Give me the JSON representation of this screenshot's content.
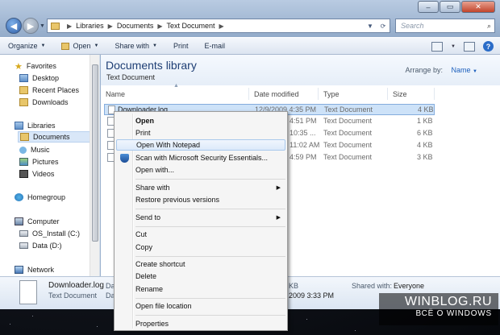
{
  "window": {
    "controls": [
      "–",
      "▭",
      "✕"
    ],
    "breadcrumbs": [
      "Libraries",
      "Documents",
      "Text Document"
    ],
    "search_placeholder": "Search"
  },
  "toolbar": {
    "organize": "Organize",
    "open": "Open",
    "share_with": "Share with",
    "print": "Print",
    "email": "E-mail"
  },
  "nav": {
    "favorites": "Favorites",
    "desktop": "Desktop",
    "recent_places": "Recent Places",
    "downloads": "Downloads",
    "libraries": "Libraries",
    "documents": "Documents",
    "music": "Music",
    "pictures": "Pictures",
    "videos": "Videos",
    "homegroup": "Homegroup",
    "computer": "Computer",
    "os_install": "OS_Install (C:)",
    "data_drive": "Data (D:)",
    "network": "Network"
  },
  "library": {
    "title": "Documents library",
    "subtitle": "Text Document",
    "arrange_label": "Arrange by:",
    "arrange_value": "Name"
  },
  "columns": {
    "name": "Name",
    "date": "Date modified",
    "type": "Type",
    "size": "Size"
  },
  "files": [
    {
      "name": "Downloader.log",
      "date": "12/9/2009 4:35 PM",
      "type": "Text Document",
      "size": "4 KB"
    },
    {
      "name": "",
      "date": "4:51 PM",
      "type": "Text Document",
      "size": "1 KB"
    },
    {
      "name": "",
      "date": "10:35 ...",
      "type": "Text Document",
      "size": "6 KB"
    },
    {
      "name": "",
      "date": "11:02 AM",
      "type": "Text Document",
      "size": "4 KB"
    },
    {
      "name": "",
      "date": "4:59 PM",
      "type": "Text Document",
      "size": "3 KB"
    }
  ],
  "context_menu": {
    "open": "Open",
    "print": "Print",
    "open_with_notepad": "Open With Notepad",
    "scan_mse": "Scan with Microsoft Security Essentials...",
    "open_with": "Open with...",
    "share_with": "Share with",
    "restore_previous": "Restore previous versions",
    "send_to": "Send to",
    "cut": "Cut",
    "copy": "Copy",
    "create_shortcut": "Create shortcut",
    "delete": "Delete",
    "rename": "Rename",
    "open_file_location": "Open file location",
    "properties": "Properties"
  },
  "details": {
    "name": "Downloader.log",
    "type": "Text Document",
    "date_fragment": "Dat",
    "date_fragment2": "Dat",
    "size_fragment": "KB",
    "date_value_fragment": "2009 3:33 PM",
    "shared_label": "Shared with:",
    "shared_value": "Everyone"
  },
  "watermark": {
    "line1": "WINBLOG.RU",
    "line2": "ВСЁ О WINDOWS"
  }
}
